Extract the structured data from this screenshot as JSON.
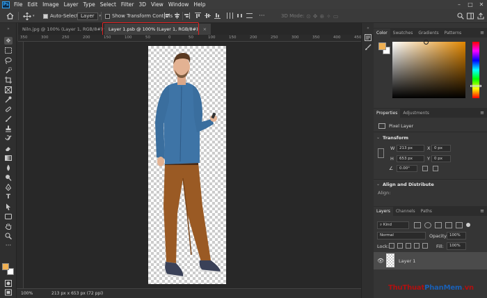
{
  "menu": {
    "logo": "Ps",
    "items": [
      "File",
      "Edit",
      "Image",
      "Layer",
      "Type",
      "Select",
      "Filter",
      "3D",
      "View",
      "Window",
      "Help"
    ],
    "window_controls": [
      "–",
      "□",
      "✕"
    ]
  },
  "options": {
    "auto_select_label": "Auto-Select:",
    "auto_select_value": "Layer",
    "show_transform_label": "Show Transform Controls",
    "mode_3d_label": "3D Mode:"
  },
  "tabs": [
    {
      "label": "Niln.jpg @ 100% (Layer 1, RGB/8#) *",
      "close": "×"
    },
    {
      "label": "Layer 1.psb @ 100% (Layer 1, RGB/8#)",
      "close": "×"
    }
  ],
  "ruler_top": [
    "350",
    "300",
    "250",
    "200",
    "150",
    "100",
    "50",
    "0",
    "50",
    "100",
    "150",
    "200",
    "250",
    "300",
    "350",
    "400",
    "450"
  ],
  "status": {
    "zoom": "100%",
    "doc_info": "213 px x 653 px (72 ppi)"
  },
  "color_panel": {
    "tabs": [
      "Color",
      "Swatches",
      "Gradients",
      "Patterns"
    ],
    "foreground": "#f0b053",
    "background": "#ffffff"
  },
  "properties": {
    "tabs": [
      "Properties",
      "Adjustments"
    ],
    "kind": "Pixel Layer",
    "transform_title": "Transform",
    "w_label": "W",
    "w_value": "213 px",
    "h_label": "H",
    "h_value": "653 px",
    "x_label": "X",
    "x_value": "0 px",
    "y_label": "Y",
    "y_value": "0 px",
    "angle_value": "0.00°",
    "align_title": "Align and Distribute",
    "align_label": "Align:"
  },
  "layers": {
    "tabs": [
      "Layers",
      "Channels",
      "Paths"
    ],
    "filter_label": "Kind",
    "blend_mode": "Normal",
    "opacity_label": "Opacity:",
    "opacity_value": "100%",
    "lock_label": "Lock:",
    "fill_label": "Fill:",
    "fill_value": "100%",
    "items": [
      {
        "name": "Layer 1",
        "visible": true
      }
    ]
  },
  "watermark": {
    "part1": "ThuThuat",
    "part2": "PhanMem",
    "part3": ".vn"
  }
}
